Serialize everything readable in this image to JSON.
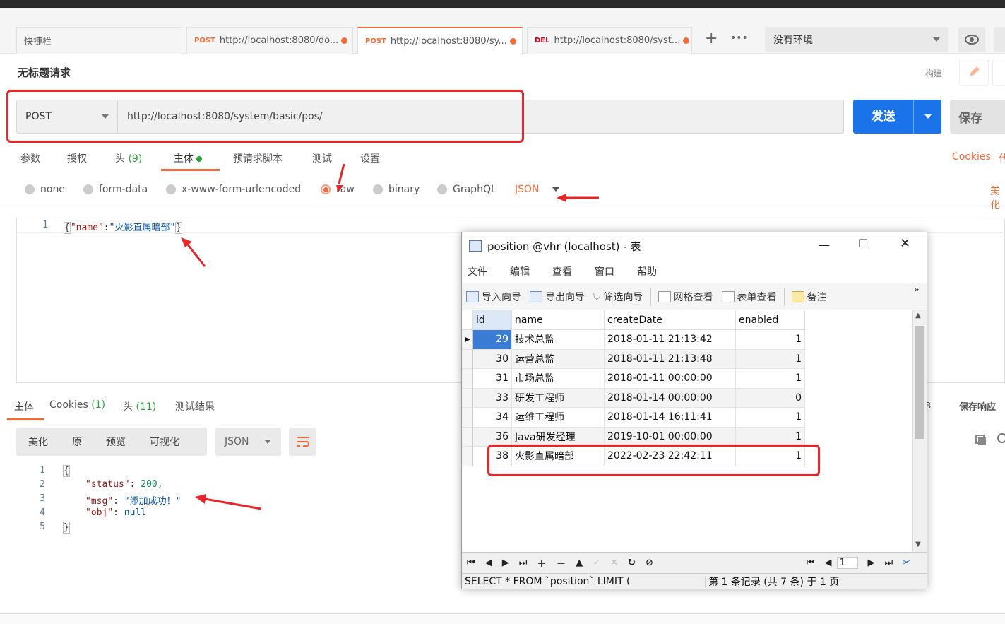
{
  "tabs": {
    "quickbar": "快捷栏",
    "items": [
      {
        "method": "POST",
        "url": "http://localhost:8080/do..."
      },
      {
        "method": "POST",
        "url": "http://localhost:8080/sy..."
      },
      {
        "method": "DEL",
        "url": "http://localhost:8080/syst..."
      }
    ],
    "add": "+",
    "more": "•••"
  },
  "env": {
    "selected": "没有环境"
  },
  "request": {
    "title": "无标题请求",
    "build_label": "构建",
    "method": "POST",
    "url": "http://localhost:8080/system/basic/pos/",
    "send_label": "发送",
    "save_label": "保存"
  },
  "req_tabs": {
    "params": "参数",
    "auth": "授权",
    "headers": "头",
    "headers_count": "(9)",
    "body": "主体",
    "prerequest": "预请求脚本",
    "tests": "测试",
    "settings": "设置",
    "cookies": "Cookies",
    "code": "代"
  },
  "body_types": {
    "none": "none",
    "form_data": "form-data",
    "urlencoded": "x-www-form-urlencoded",
    "raw": "raw",
    "binary": "binary",
    "graphql": "GraphQL",
    "json": "JSON",
    "beautify": "美化"
  },
  "req_body": {
    "line": "1",
    "open": "{",
    "key": "\"name\"",
    "colon": ":",
    "value": "\"火影直属暗部\"",
    "close": "}"
  },
  "res_tabs": {
    "body": "主体",
    "cookies": "Cookies",
    "cookies_count": "(1)",
    "headers": "头",
    "headers_count": "(11)",
    "test_results": "测试结果",
    "size_suffix": "B",
    "save_response": "保存响应"
  },
  "res_format": {
    "pretty": "美化",
    "raw": "原",
    "preview": "预览",
    "visualize": "可视化",
    "lang": "JSON"
  },
  "res_body": {
    "lines": [
      "1",
      "2",
      "3",
      "4",
      "5"
    ],
    "l1": "{",
    "status_key": "\"status\"",
    "status_val": "200,",
    "msg_key": "\"msg\"",
    "msg_val": "\"添加成功！\"",
    "obj_key": "\"obj\"",
    "obj_val": "null",
    "l5": "}"
  },
  "navicat": {
    "title": "position @vhr (localhost) - 表",
    "menu": [
      "文件",
      "编辑",
      "查看",
      "窗口",
      "帮助"
    ],
    "toolbar": [
      "导入向导",
      "导出向导",
      "筛选向导",
      "网格查看",
      "表单查看",
      "备注"
    ],
    "more": "»",
    "columns": [
      "id",
      "name",
      "createDate",
      "enabled"
    ],
    "rows": [
      {
        "id": "29",
        "name": "技术总监",
        "createDate": "2018-01-11 21:13:42",
        "enabled": "1"
      },
      {
        "id": "30",
        "name": "运营总监",
        "createDate": "2018-01-11 21:13:48",
        "enabled": "1"
      },
      {
        "id": "31",
        "name": "市场总监",
        "createDate": "2018-01-11 00:00:00",
        "enabled": "1"
      },
      {
        "id": "33",
        "name": "研发工程师",
        "createDate": "2018-01-14 00:00:00",
        "enabled": "0"
      },
      {
        "id": "34",
        "name": "运维工程师",
        "createDate": "2018-01-14 16:11:41",
        "enabled": "1"
      },
      {
        "id": "36",
        "name": "Java研发经理",
        "createDate": "2019-10-01 00:00:00",
        "enabled": "1"
      },
      {
        "id": "38",
        "name": "火影直属暗部",
        "createDate": "2022-02-23 22:42:11",
        "enabled": "1"
      }
    ],
    "page_value": "1",
    "sql": "SELECT * FROM `position` LIMIT (",
    "record_info": "第 1 条记录 (共 7 条) 于 1 页"
  },
  "colors": {
    "accent": "#f26b3a",
    "send": "#1a73e8",
    "annotation": "#e8262a",
    "selected_row": "#3a7bd5"
  }
}
